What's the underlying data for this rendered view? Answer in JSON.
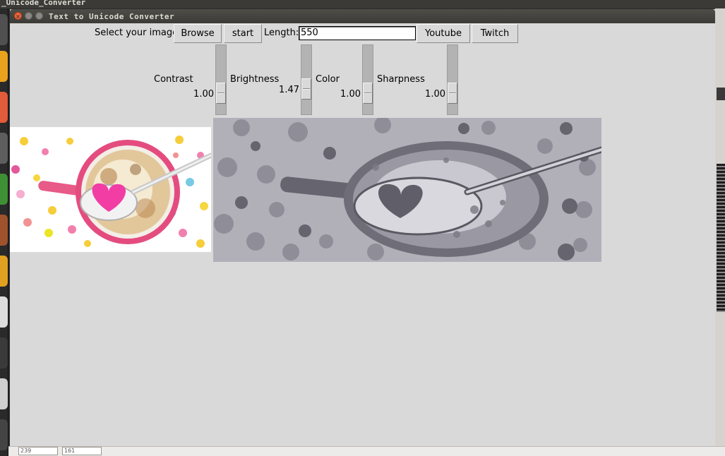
{
  "desktop": {
    "top_title": "_Unicode_Converter",
    "spin_values": [
      "239",
      "161"
    ]
  },
  "window": {
    "title": "Text to Unicode Converter"
  },
  "toolbar": {
    "select_label": "Select your image",
    "browse_label": "Browse",
    "start_label": "start",
    "length_label": "Length:",
    "length_value": "550",
    "youtube_label": "Youtube",
    "twitch_label": "Twitch"
  },
  "scales": {
    "contrast": {
      "label": "Contrast",
      "value": "1.00"
    },
    "brightness": {
      "label": "Brightness",
      "value": "1.47"
    },
    "color": {
      "label": "Color",
      "value": "1.00"
    },
    "sharpness": {
      "label": "Sharpness",
      "value": "1.00"
    }
  },
  "images": {
    "original_icon": "coffee-cup-heart-spoon",
    "converted_icon": "posterized-grayscale-coffee-cup"
  },
  "colors": {
    "window_bg": "#d9d9d9",
    "close_button": "#f0643a",
    "titlebar": "#3c3b37",
    "heart_pink": "#f23da4",
    "cup_pink": "#e44c80"
  }
}
